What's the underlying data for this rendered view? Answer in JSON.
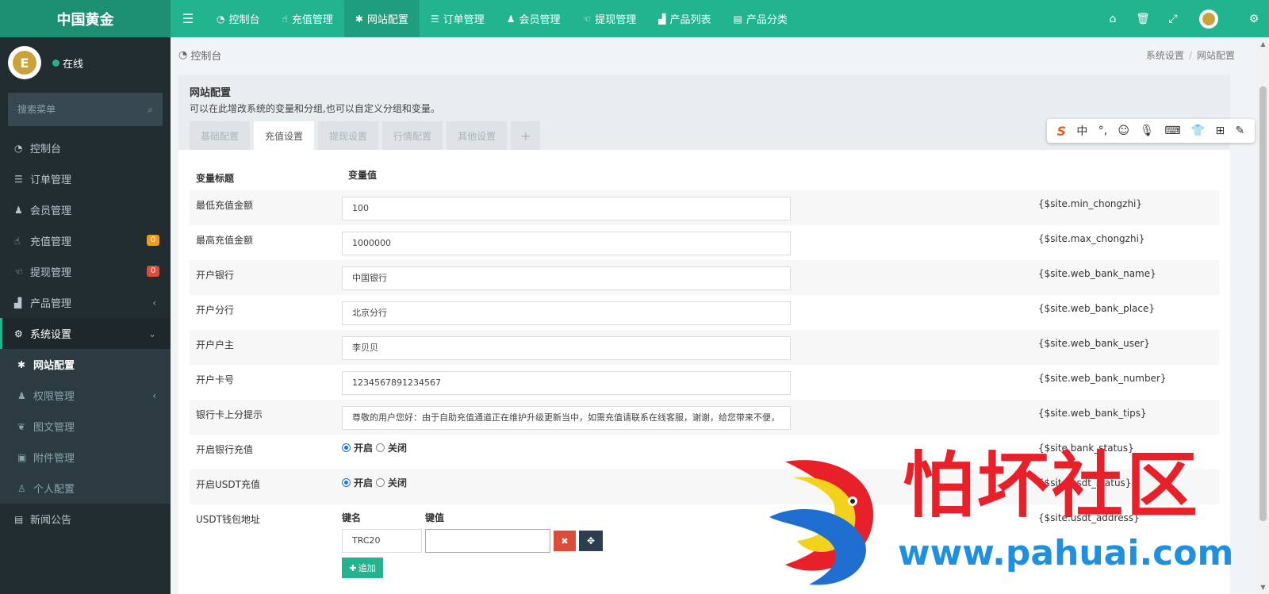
{
  "brand": "中国黄金",
  "nav": {
    "items": [
      {
        "icon": "dashboard-icon",
        "glyph": "◔",
        "label": "控制台"
      },
      {
        "icon": "hand-icon",
        "glyph": "☝",
        "label": "充值管理"
      },
      {
        "icon": "gear-icon",
        "glyph": "✱",
        "label": "网站配置"
      },
      {
        "icon": "list-icon",
        "glyph": "☰",
        "label": "订单管理"
      },
      {
        "icon": "users-icon",
        "glyph": "♟",
        "label": "会员管理"
      },
      {
        "icon": "hand-icon",
        "glyph": "☜",
        "label": "提现管理"
      },
      {
        "icon": "bag-icon",
        "glyph": "▟",
        "label": "产品列表"
      },
      {
        "icon": "table-icon",
        "glyph": "▤",
        "label": "产品分类"
      }
    ]
  },
  "user": {
    "status": "在线"
  },
  "search": {
    "placeholder": "搜索菜单"
  },
  "sidebar": {
    "items": [
      {
        "label": "控制台"
      },
      {
        "label": "订单管理"
      },
      {
        "label": "会员管理"
      },
      {
        "label": "充值管理",
        "badge": "0"
      },
      {
        "label": "提现管理",
        "badge": "0"
      },
      {
        "label": "产品管理"
      },
      {
        "label": "系统设置"
      }
    ],
    "sub": [
      {
        "label": "网站配置"
      },
      {
        "label": "权限管理"
      },
      {
        "label": "图文管理"
      },
      {
        "label": "附件管理"
      },
      {
        "label": "个人配置"
      }
    ],
    "last": {
      "label": "新闻公告"
    }
  },
  "breadcrumb": {
    "current": "控制台",
    "right1": "系统设置",
    "sep": "/",
    "right2": "网站配置"
  },
  "panel": {
    "title": "网站配置",
    "desc": "可以在此增改系统的变量和分组,也可以自定义分组和变量。",
    "tabs": [
      "基础配置",
      "充值设置",
      "提现设置",
      "行情配置",
      "其他设置",
      "+"
    ]
  },
  "table": {
    "headers": {
      "title": "变量标题",
      "value": "变量值"
    },
    "rows": [
      {
        "title": "最低充值金额",
        "value": "100",
        "var": "{$site.min_chongzhi}"
      },
      {
        "title": "最高充值金额",
        "value": "1000000",
        "var": "{$site.max_chongzhi}"
      },
      {
        "title": "开户银行",
        "value": "中国银行",
        "var": "{$site.web_bank_name}"
      },
      {
        "title": "开户分行",
        "value": "北京分行",
        "var": "{$site.web_bank_place}"
      },
      {
        "title": "开户户主",
        "value": "李贝贝",
        "var": "{$site.web_bank_user}"
      },
      {
        "title": "开户卡号",
        "value": "1234567891234567",
        "var": "{$site.web_bank_number}"
      },
      {
        "title": "银行卡上分提示",
        "value": "尊敬的用户您好：由于自助充值通道正在维护升级更新当中，如需充值请联系在线客服，谢谢，给您带来不便，",
        "var": "{$site.web_bank_tips}"
      },
      {
        "title": "开启银行充值",
        "on": "开启",
        "off": "关闭",
        "var": "{$site.bank_status}"
      },
      {
        "title": "开启USDT充值",
        "on": "开启",
        "off": "关闭",
        "var": "{$site.usdt_status}"
      },
      {
        "title": "USDT钱包地址",
        "key_label": "键名",
        "val_label": "键值",
        "key": "TRC20",
        "add": "追加",
        "var": "{$site.usdt_address}"
      }
    ]
  },
  "ime": {
    "cn": "中"
  },
  "watermark": {
    "text": "怕坏社区",
    "url": "www.pahuai.com"
  },
  "colors": {
    "accent": "#22b38f",
    "sidebar": "#222d32",
    "danger": "#dd4b39",
    "warning": "#f39c12"
  }
}
